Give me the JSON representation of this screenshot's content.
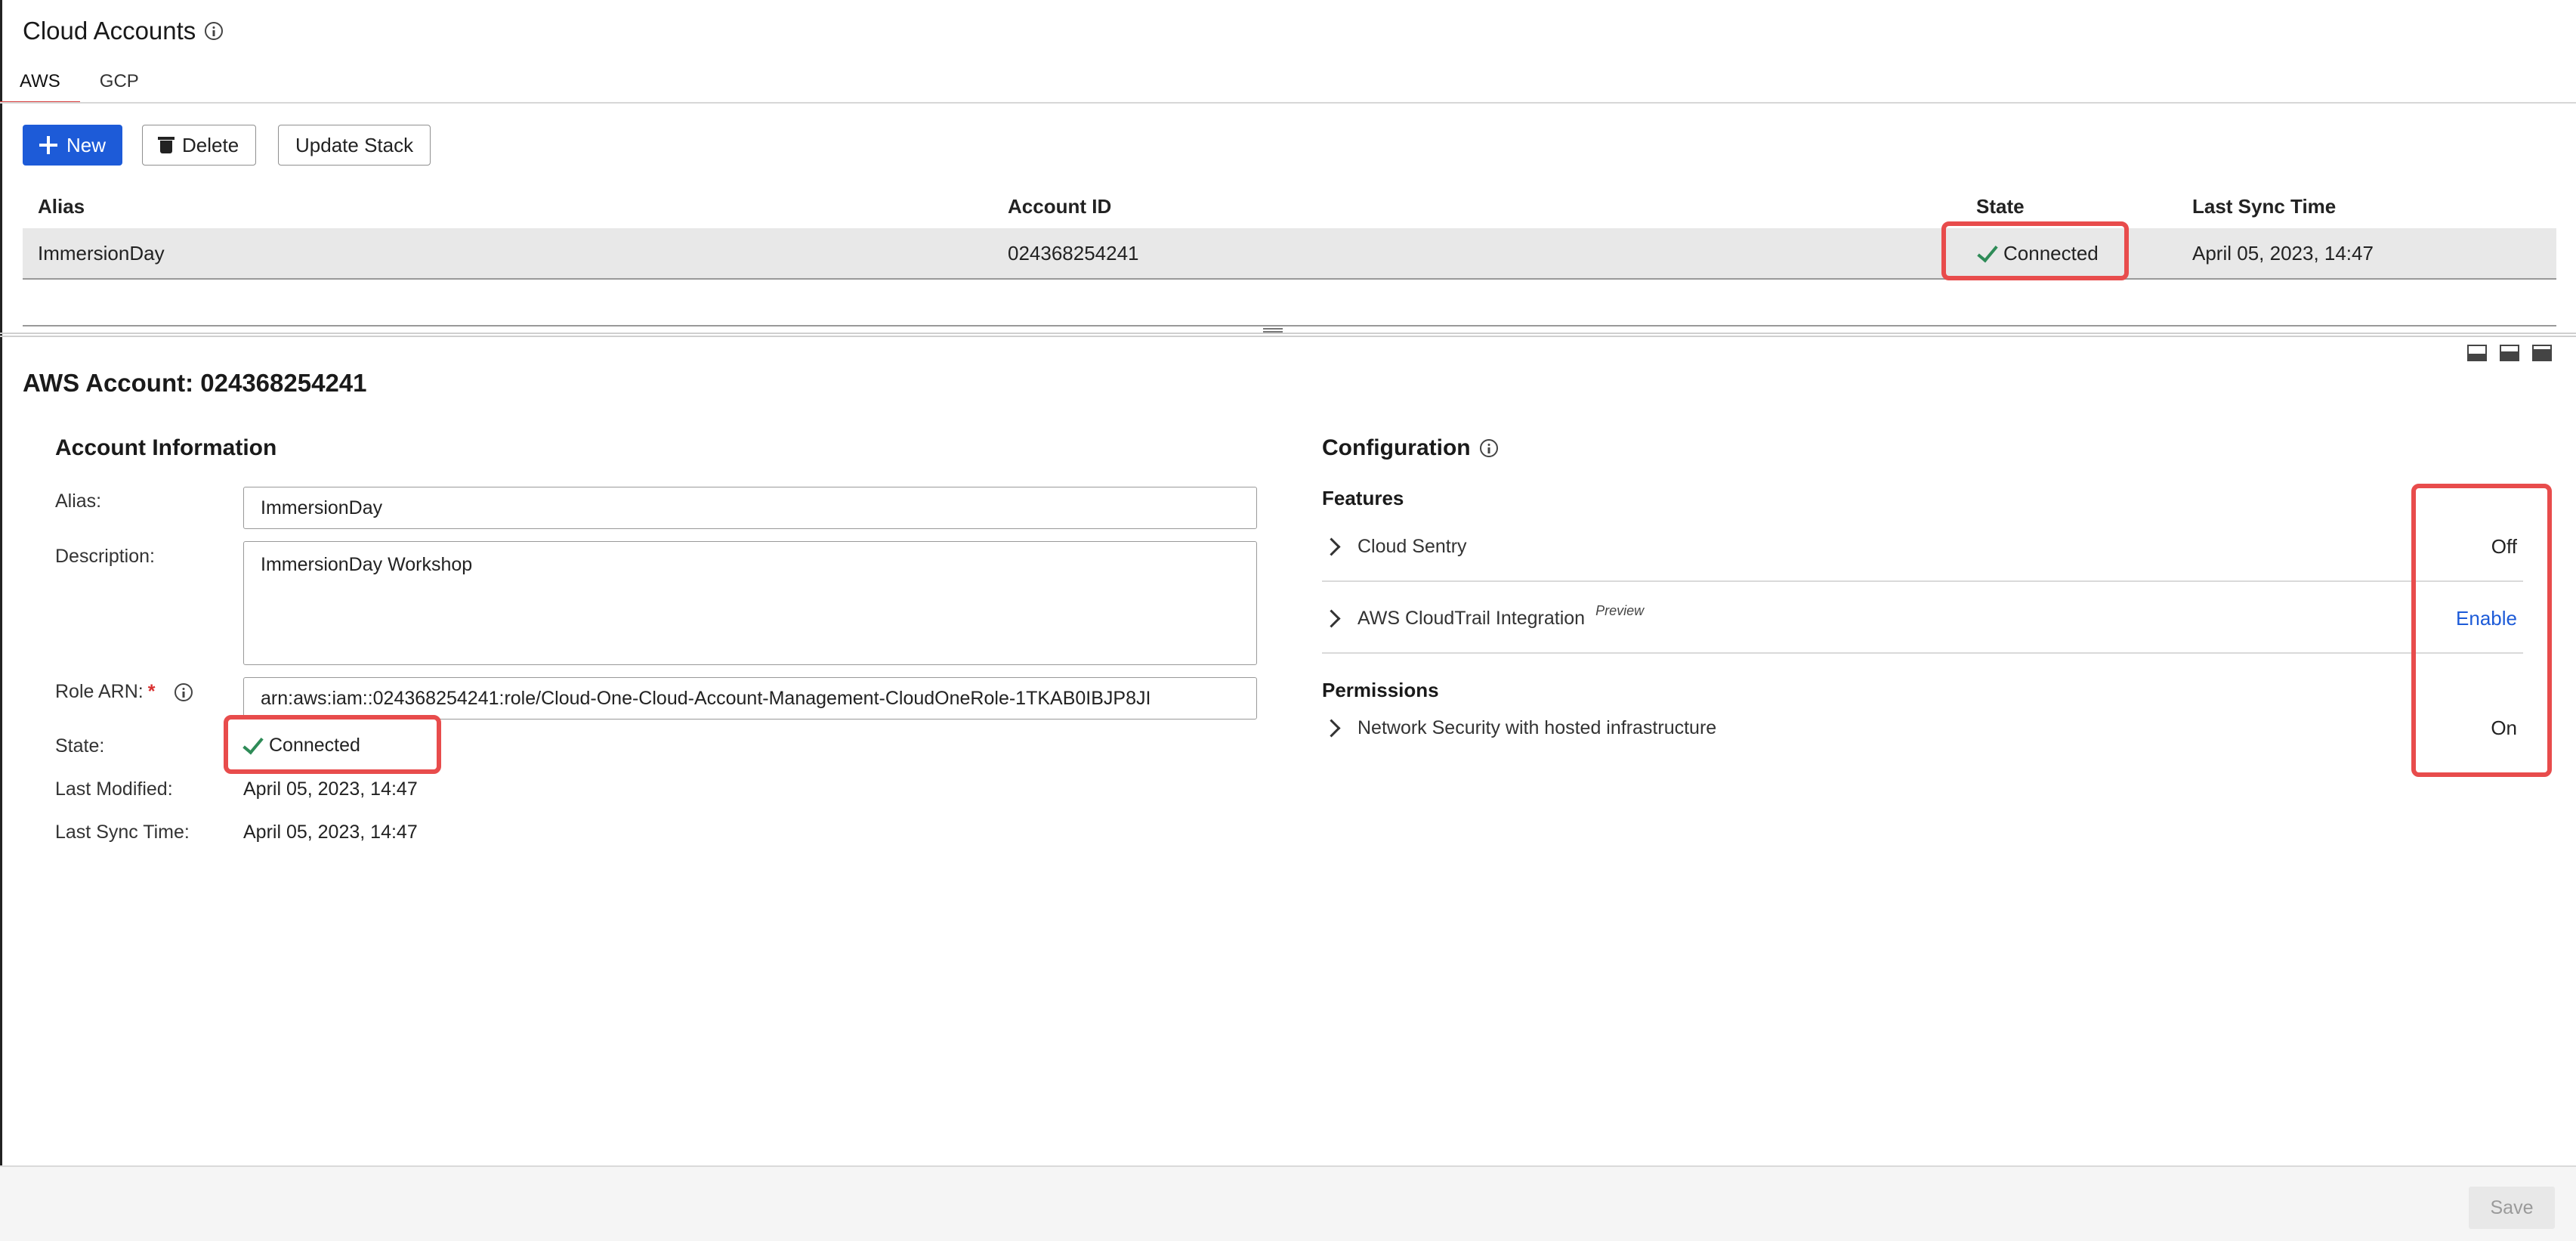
{
  "header": {
    "title": "Cloud Accounts"
  },
  "tabs": [
    {
      "label": "AWS",
      "active": true
    },
    {
      "label": "GCP",
      "active": false
    }
  ],
  "toolbar": {
    "new_label": "New",
    "delete_label": "Delete",
    "update_stack_label": "Update Stack"
  },
  "table": {
    "columns": [
      "Alias",
      "Account ID",
      "State",
      "Last Sync Time"
    ],
    "rows": [
      {
        "alias": "ImmersionDay",
        "account_id": "024368254241",
        "state": "Connected",
        "last_sync": "April 05, 2023, 14:47"
      }
    ]
  },
  "detail": {
    "title": "AWS Account: 024368254241",
    "account_info": {
      "heading": "Account Information",
      "alias_label": "Alias:",
      "alias_value": "ImmersionDay",
      "description_label": "Description:",
      "description_value": "ImmersionDay Workshop",
      "role_arn_label": "Role ARN:",
      "role_arn_required": "*",
      "role_arn_value": "arn:aws:iam::024368254241:role/Cloud-One-Cloud-Account-Management-CloudOneRole-1TKAB0IBJP8JI",
      "state_label": "State:",
      "state_value": "Connected",
      "last_modified_label": "Last Modified:",
      "last_modified_value": "April 05, 2023, 14:47",
      "last_sync_label": "Last Sync Time:",
      "last_sync_value": "April 05, 2023, 14:47"
    },
    "configuration": {
      "heading": "Configuration",
      "features_heading": "Features",
      "features": [
        {
          "name": "Cloud Sentry",
          "status": "Off"
        },
        {
          "name": "AWS CloudTrail Integration",
          "tag": "Preview",
          "status": "Enable"
        }
      ],
      "permissions_heading": "Permissions",
      "permissions": [
        {
          "name": "Network Security with hosted infrastructure",
          "status": "On"
        }
      ]
    }
  },
  "footer": {
    "save_label": "Save"
  },
  "colors": {
    "primary": "#1d5bd8",
    "tab_active": "#d94040",
    "highlight": "#e84c4c",
    "success": "#2e8b57",
    "link": "#1d5bd8"
  },
  "icons": [
    "info-icon",
    "plus-icon",
    "trash-icon",
    "check-icon",
    "chevron-right-icon",
    "view-bottom-icon",
    "view-split-icon",
    "view-top-icon"
  ]
}
